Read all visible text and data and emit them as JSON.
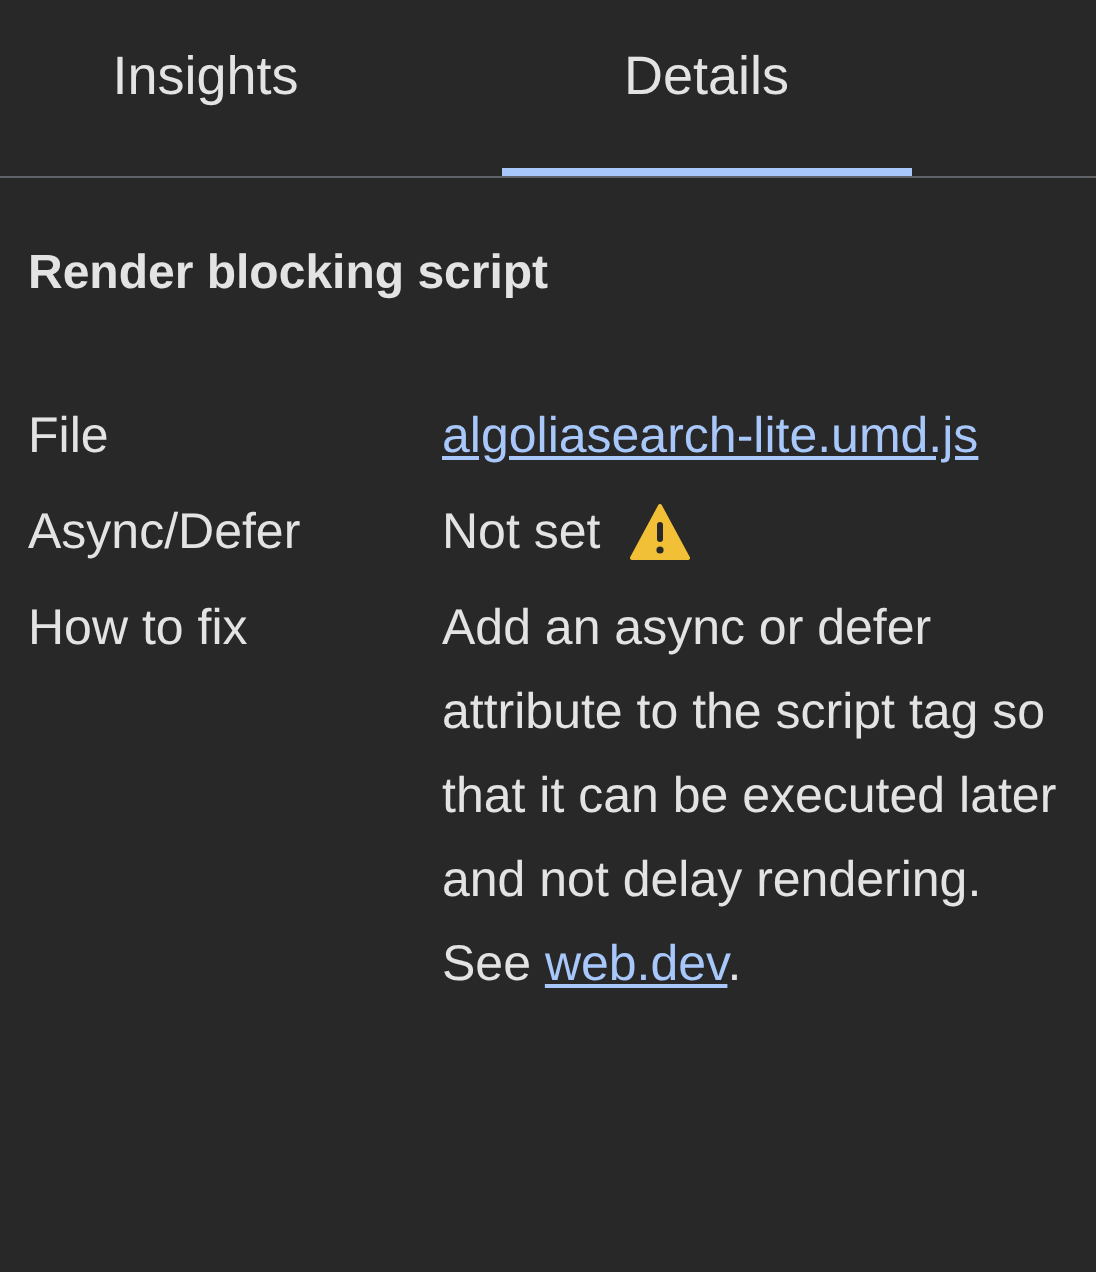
{
  "tabs": [
    {
      "label": "Insights",
      "selected": false
    },
    {
      "label": "Details",
      "selected": true
    }
  ],
  "title": "Render blocking script",
  "rows": [
    {
      "kind": "link",
      "label": "File",
      "value": "algoliasearch-lite.umd.js"
    },
    {
      "kind": "warning",
      "label": "Async/Defer",
      "value": "Not set"
    },
    {
      "kind": "text",
      "label": "How to fix",
      "value": "Add an async or defer attribute to the script tag so that it can be executed later and not delay rendering. See",
      "link": "web.dev",
      "suffix": "."
    }
  ]
}
